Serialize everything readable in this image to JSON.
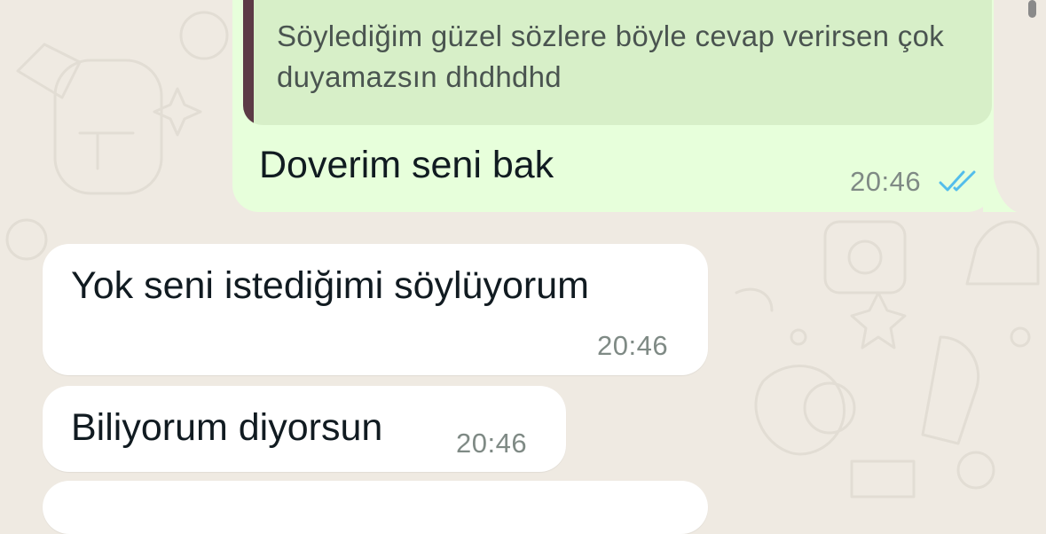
{
  "chat": {
    "messages": [
      {
        "direction": "outgoing",
        "quoted_text": "Söylediğim güzel sözlere böyle cevap verirsen çok duyamazsın dhdhdhd",
        "text": "Doverim seni bak",
        "time": "20:46",
        "status_icon": "double-check-read-icon"
      },
      {
        "direction": "incoming",
        "text": "Yok seni istediğimi söylüyorum",
        "time": "20:46"
      },
      {
        "direction": "incoming",
        "text": "Biliyorum diyorsun",
        "time": "20:46"
      }
    ]
  },
  "colors": {
    "wallpaper": "#efeae2",
    "outgoing_bubble": "#e7ffdb",
    "quote_background": "#d7efc8",
    "quote_bar": "#5c3a46",
    "incoming_bubble": "#ffffff",
    "read_ticks": "#53bdeb"
  }
}
